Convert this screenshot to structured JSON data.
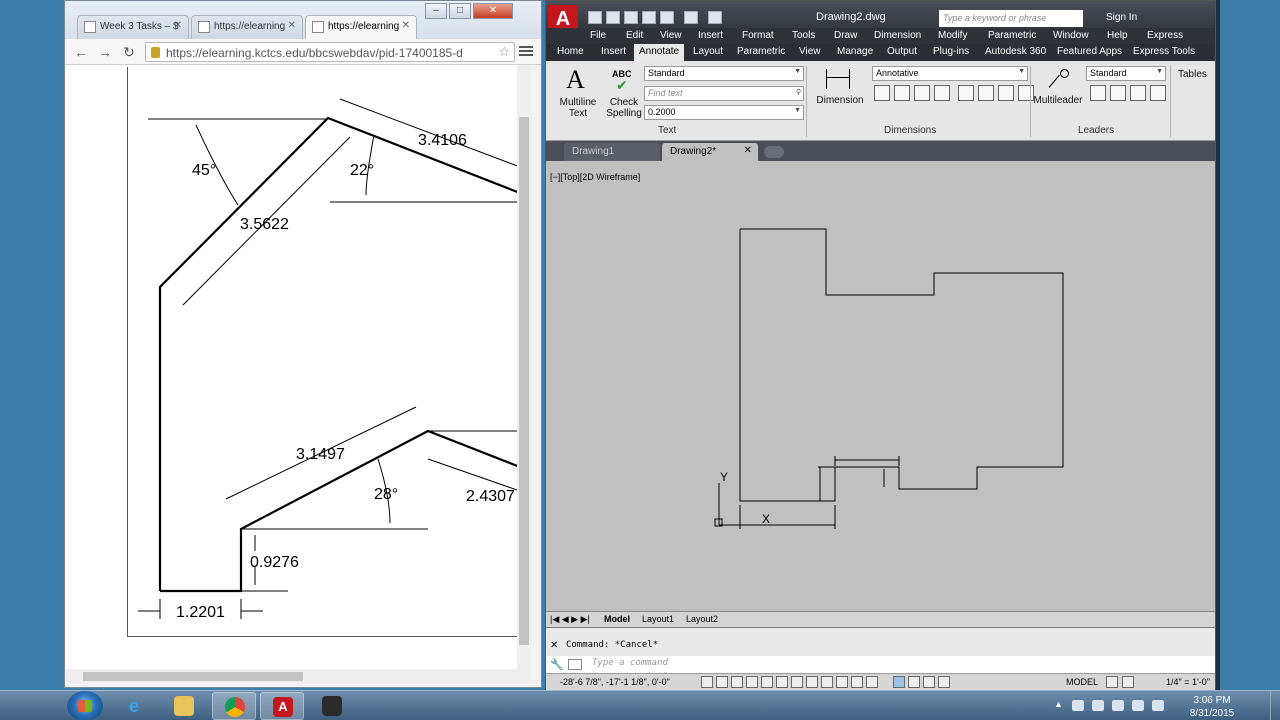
{
  "chrome": {
    "tabs": [
      {
        "label": "Week 3 Tasks – $"
      },
      {
        "label": "https://elearning"
      },
      {
        "label": "https://elearning"
      }
    ],
    "url": "https://elearning.kctcs.edu/bbcswebdav/pid-17400185-d",
    "window_buttons": {
      "minimize": "–",
      "maximize": "□",
      "close": "✕"
    }
  },
  "pdf_figure": {
    "dimensions": [
      "45°",
      "3.4106",
      "22°",
      "3.5622",
      "3.1497",
      "2.4307",
      "28°",
      "0.9276",
      "1.2201"
    ]
  },
  "autocad": {
    "title": "Drawing2.dwg",
    "search_placeholder": "Type a keyword or phrase",
    "sign_in": "Sign In",
    "menu": [
      "File",
      "Edit",
      "View",
      "Insert",
      "Format",
      "Tools",
      "Draw",
      "Dimension",
      "Modify",
      "Parametric",
      "Window",
      "Help",
      "Express"
    ],
    "ribbon_tabs": [
      "Home",
      "Insert",
      "Annotate",
      "Layout",
      "Parametric",
      "View",
      "Manage",
      "Output",
      "Plug-ins",
      "Autodesk 360",
      "Featured Apps",
      "Express Tools"
    ],
    "active_ribbon_tab": "Annotate",
    "ribbon": {
      "multiline_text": "Multiline\nText",
      "check_spelling": "Check\nSpelling",
      "abc": "ABC",
      "text_style": "Standard",
      "find_text_placeholder": "Find text",
      "text_height": "0.2000",
      "text_panel": "Text",
      "dimension": "Dimension",
      "dim_style": "Annotative",
      "dimensions_panel": "Dimensions",
      "multileader": "Multileader",
      "leader_style": "Standard",
      "leaders_panel": "Leaders",
      "tables": "Tables"
    },
    "doc_tabs": [
      {
        "label": "Drawing1"
      },
      {
        "label": "Drawing2*"
      }
    ],
    "viewport_label": "[−][Top][2D Wireframe]",
    "ucs_y": "Y",
    "ucs_x": "X",
    "layout_tabs": [
      "Model",
      "Layout1",
      "Layout2"
    ],
    "command_history": "Command: *Cancel*",
    "command_placeholder": "Type a command",
    "coordinates": "-28'-6 7/8\", -17'-1 1/8\", 0'-0\"",
    "model_label": "MODEL",
    "scale_label": "1/4\" = 1'-0\""
  },
  "taskbar": {
    "time": "3:06 PM",
    "date": "8/31/2015"
  },
  "colors": {
    "desktop": "#3f7eaa",
    "autocad_red": "#c4161c",
    "cad_background": "#c0c0c0"
  }
}
